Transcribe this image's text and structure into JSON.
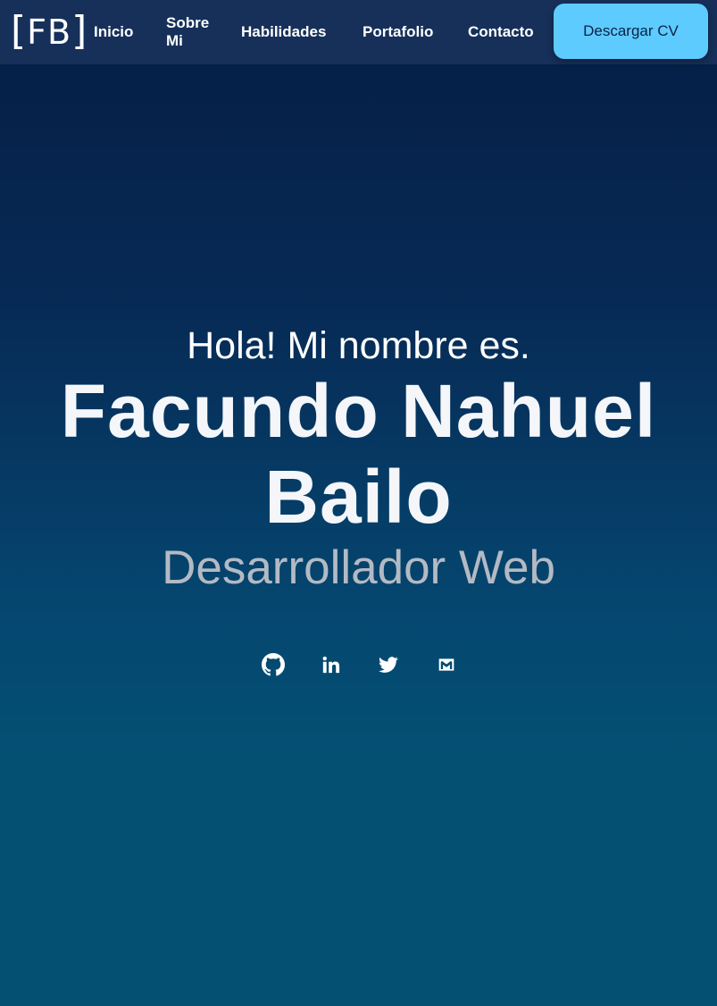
{
  "nav": {
    "logo": "FB",
    "links": [
      "Inicio",
      "Sobre Mi",
      "Habilidades",
      "Portafolio",
      "Contacto"
    ],
    "cv_button": "Descargar CV"
  },
  "hero": {
    "greeting": "Hola! Mi nombre es.",
    "name": "Facundo Nahuel Bailo",
    "role": "Desarrollador Web"
  },
  "socials": [
    {
      "icon": "github-icon"
    },
    {
      "icon": "linkedin-icon"
    },
    {
      "icon": "twitter-icon"
    },
    {
      "icon": "mail-icon"
    }
  ],
  "colors": {
    "nav_bg": "#16305a",
    "accent": "#5ecbff",
    "bg_top": "#051d45",
    "bg_bottom": "#045073",
    "role_text": "#b3bac4"
  }
}
